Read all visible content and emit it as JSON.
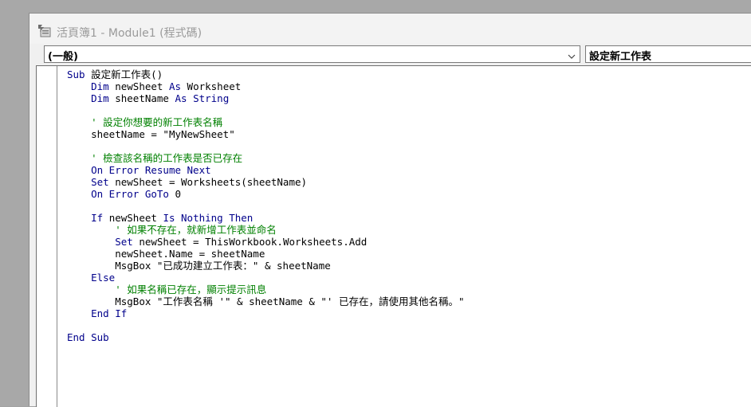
{
  "window": {
    "title": "活頁簿1 - Module1 (程式碼)",
    "icon": "vba-module-icon"
  },
  "object_combo": {
    "value": "(一般)"
  },
  "procedure_combo": {
    "value": "設定新工作表"
  },
  "colors": {
    "keyword": "#00008b",
    "comment": "#008000",
    "text": "#000000"
  },
  "code_lines": [
    {
      "indent": 0,
      "tokens": [
        {
          "t": "kw",
          "v": "Sub"
        },
        {
          "t": "tx",
          "v": " 設定新工作表()"
        }
      ]
    },
    {
      "indent": 1,
      "tokens": [
        {
          "t": "kw",
          "v": "Dim"
        },
        {
          "t": "tx",
          "v": " newSheet "
        },
        {
          "t": "kw",
          "v": "As"
        },
        {
          "t": "tx",
          "v": " Worksheet"
        }
      ]
    },
    {
      "indent": 1,
      "tokens": [
        {
          "t": "kw",
          "v": "Dim"
        },
        {
          "t": "tx",
          "v": " sheetName "
        },
        {
          "t": "kw",
          "v": "As"
        },
        {
          "t": "kw",
          "v": " String"
        }
      ]
    },
    {
      "indent": 0,
      "tokens": []
    },
    {
      "indent": 1,
      "tokens": [
        {
          "t": "cm",
          "v": "' 設定你想要的新工作表名稱"
        }
      ]
    },
    {
      "indent": 1,
      "tokens": [
        {
          "t": "tx",
          "v": "sheetName = \"MyNewSheet\""
        }
      ]
    },
    {
      "indent": 0,
      "tokens": []
    },
    {
      "indent": 1,
      "tokens": [
        {
          "t": "cm",
          "v": "' 檢查該名稱的工作表是否已存在"
        }
      ]
    },
    {
      "indent": 1,
      "tokens": [
        {
          "t": "kw",
          "v": "On Error Resume Next"
        }
      ]
    },
    {
      "indent": 1,
      "tokens": [
        {
          "t": "kw",
          "v": "Set"
        },
        {
          "t": "tx",
          "v": " newSheet = Worksheets(sheetName)"
        }
      ]
    },
    {
      "indent": 1,
      "tokens": [
        {
          "t": "kw",
          "v": "On Error GoTo"
        },
        {
          "t": "tx",
          "v": " 0"
        }
      ]
    },
    {
      "indent": 0,
      "tokens": []
    },
    {
      "indent": 1,
      "tokens": [
        {
          "t": "kw",
          "v": "If"
        },
        {
          "t": "tx",
          "v": " newSheet "
        },
        {
          "t": "kw",
          "v": "Is Nothing Then"
        }
      ]
    },
    {
      "indent": 2,
      "tokens": [
        {
          "t": "cm",
          "v": "' 如果不存在，就新增工作表並命名"
        }
      ]
    },
    {
      "indent": 2,
      "tokens": [
        {
          "t": "kw",
          "v": "Set"
        },
        {
          "t": "tx",
          "v": " newSheet = ThisWorkbook.Worksheets.Add"
        }
      ]
    },
    {
      "indent": 2,
      "tokens": [
        {
          "t": "tx",
          "v": "newSheet.Name = sheetName"
        }
      ]
    },
    {
      "indent": 2,
      "tokens": [
        {
          "t": "tx",
          "v": "MsgBox \"已成功建立工作表：\" & sheetName"
        }
      ]
    },
    {
      "indent": 1,
      "tokens": [
        {
          "t": "kw",
          "v": "Else"
        }
      ]
    },
    {
      "indent": 2,
      "tokens": [
        {
          "t": "cm",
          "v": "' 如果名稱已存在，顯示提示訊息"
        }
      ]
    },
    {
      "indent": 2,
      "tokens": [
        {
          "t": "tx",
          "v": "MsgBox \"工作表名稱 '\" & sheetName & \"' 已存在，請使用其他名稱。\""
        }
      ]
    },
    {
      "indent": 1,
      "tokens": [
        {
          "t": "kw",
          "v": "End If"
        }
      ]
    },
    {
      "indent": 0,
      "tokens": []
    },
    {
      "indent": 0,
      "tokens": [
        {
          "t": "kw",
          "v": "End Sub"
        }
      ]
    }
  ]
}
